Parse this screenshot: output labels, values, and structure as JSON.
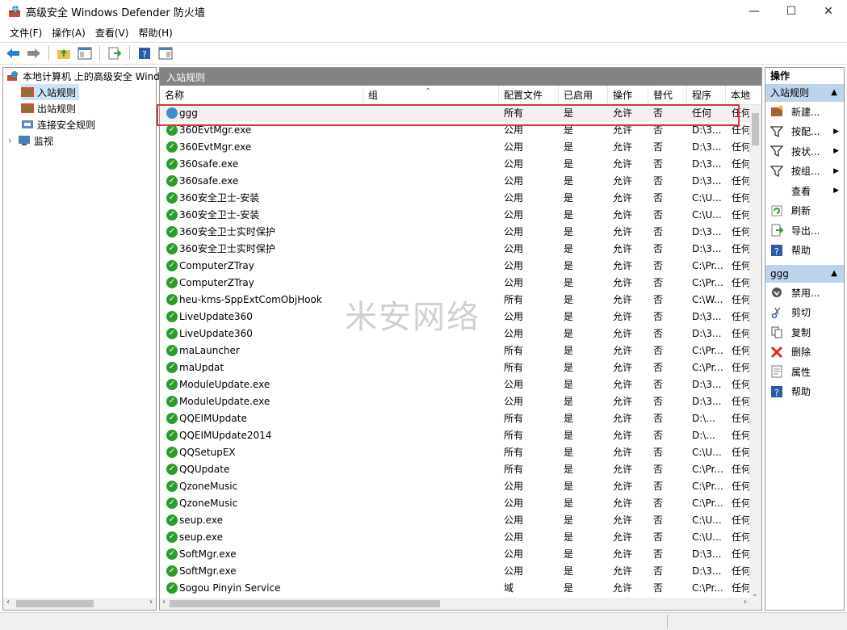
{
  "window": {
    "title": "高级安全 Windows Defender 防火墙",
    "minimize": "—",
    "maximize": "☐",
    "close": "✕"
  },
  "menu": [
    "文件(F)",
    "操作(A)",
    "查看(V)",
    "帮助(H)"
  ],
  "toolbar_icons": [
    "back-arrow-icon",
    "forward-arrow-icon",
    "up-folder-icon",
    "show-hide-tree-icon",
    "export-icon",
    "help-icon",
    "view-pane-icon"
  ],
  "tree": {
    "root": "本地计算机 上的高级安全 Windows Defender",
    "items": [
      "入站规则",
      "出站规则",
      "连接安全规则",
      "监视"
    ],
    "expander": "›"
  },
  "center": {
    "title": "入站规则",
    "columns": [
      "名称",
      "组",
      "配置文件",
      "已启用",
      "操作",
      "替代",
      "程序",
      "本地"
    ],
    "rows": [
      {
        "name": "ggg",
        "group": "",
        "profile": "所有",
        "enabled": "是",
        "action": "允许",
        "override": "否",
        "program": "任何",
        "local": "任何",
        "icon": "globe"
      },
      {
        "name": "360EvtMgr.exe",
        "group": "",
        "profile": "公用",
        "enabled": "是",
        "action": "允许",
        "override": "否",
        "program": "D:\\3...",
        "local": "任何",
        "icon": "check"
      },
      {
        "name": "360EvtMgr.exe",
        "group": "",
        "profile": "公用",
        "enabled": "是",
        "action": "允许",
        "override": "否",
        "program": "D:\\3...",
        "local": "任何",
        "icon": "check"
      },
      {
        "name": "360safe.exe",
        "group": "",
        "profile": "公用",
        "enabled": "是",
        "action": "允许",
        "override": "否",
        "program": "D:\\3...",
        "local": "任何",
        "icon": "check"
      },
      {
        "name": "360safe.exe",
        "group": "",
        "profile": "公用",
        "enabled": "是",
        "action": "允许",
        "override": "否",
        "program": "D:\\3...",
        "local": "任何",
        "icon": "check"
      },
      {
        "name": "360安全卫士-安装",
        "group": "",
        "profile": "公用",
        "enabled": "是",
        "action": "允许",
        "override": "否",
        "program": "C:\\U...",
        "local": "任何",
        "icon": "check"
      },
      {
        "name": "360安全卫士-安装",
        "group": "",
        "profile": "公用",
        "enabled": "是",
        "action": "允许",
        "override": "否",
        "program": "C:\\U...",
        "local": "任何",
        "icon": "check"
      },
      {
        "name": "360安全卫士实时保护",
        "group": "",
        "profile": "公用",
        "enabled": "是",
        "action": "允许",
        "override": "否",
        "program": "D:\\3...",
        "local": "任何",
        "icon": "check"
      },
      {
        "name": "360安全卫士实时保护",
        "group": "",
        "profile": "公用",
        "enabled": "是",
        "action": "允许",
        "override": "否",
        "program": "D:\\3...",
        "local": "任何",
        "icon": "check"
      },
      {
        "name": "ComputerZTray",
        "group": "",
        "profile": "公用",
        "enabled": "是",
        "action": "允许",
        "override": "否",
        "program": "C:\\Pr...",
        "local": "任何",
        "icon": "check"
      },
      {
        "name": "ComputerZTray",
        "group": "",
        "profile": "公用",
        "enabled": "是",
        "action": "允许",
        "override": "否",
        "program": "C:\\Pr...",
        "local": "任何",
        "icon": "check"
      },
      {
        "name": "heu-kms-SppExtComObjHook",
        "group": "",
        "profile": "所有",
        "enabled": "是",
        "action": "允许",
        "override": "否",
        "program": "C:\\W...",
        "local": "任何",
        "icon": "check"
      },
      {
        "name": "LiveUpdate360",
        "group": "",
        "profile": "公用",
        "enabled": "是",
        "action": "允许",
        "override": "否",
        "program": "D:\\3...",
        "local": "任何",
        "icon": "check"
      },
      {
        "name": "LiveUpdate360",
        "group": "",
        "profile": "公用",
        "enabled": "是",
        "action": "允许",
        "override": "否",
        "program": "D:\\3...",
        "local": "任何",
        "icon": "check"
      },
      {
        "name": "maLauncher",
        "group": "",
        "profile": "所有",
        "enabled": "是",
        "action": "允许",
        "override": "否",
        "program": "C:\\Pr...",
        "local": "任何",
        "icon": "check"
      },
      {
        "name": "maUpdat",
        "group": "",
        "profile": "所有",
        "enabled": "是",
        "action": "允许",
        "override": "否",
        "program": "C:\\Pr...",
        "local": "任何",
        "icon": "check"
      },
      {
        "name": "ModuleUpdate.exe",
        "group": "",
        "profile": "公用",
        "enabled": "是",
        "action": "允许",
        "override": "否",
        "program": "D:\\3...",
        "local": "任何",
        "icon": "check"
      },
      {
        "name": "ModuleUpdate.exe",
        "group": "",
        "profile": "公用",
        "enabled": "是",
        "action": "允许",
        "override": "否",
        "program": "D:\\3...",
        "local": "任何",
        "icon": "check"
      },
      {
        "name": "QQEIMUpdate",
        "group": "",
        "profile": "所有",
        "enabled": "是",
        "action": "允许",
        "override": "否",
        "program": "D:\\...",
        "local": "任何",
        "icon": "check"
      },
      {
        "name": "QQEIMUpdate2014",
        "group": "",
        "profile": "所有",
        "enabled": "是",
        "action": "允许",
        "override": "否",
        "program": "D:\\...",
        "local": "任何",
        "icon": "check"
      },
      {
        "name": "QQSetupEX",
        "group": "",
        "profile": "所有",
        "enabled": "是",
        "action": "允许",
        "override": "否",
        "program": "C:\\U...",
        "local": "任何",
        "icon": "check"
      },
      {
        "name": "QQUpdate",
        "group": "",
        "profile": "所有",
        "enabled": "是",
        "action": "允许",
        "override": "否",
        "program": "C:\\Pr...",
        "local": "任何",
        "icon": "check"
      },
      {
        "name": "QzoneMusic",
        "group": "",
        "profile": "公用",
        "enabled": "是",
        "action": "允许",
        "override": "否",
        "program": "C:\\Pr...",
        "local": "任何",
        "icon": "check"
      },
      {
        "name": "QzoneMusic",
        "group": "",
        "profile": "公用",
        "enabled": "是",
        "action": "允许",
        "override": "否",
        "program": "C:\\Pr...",
        "local": "任何",
        "icon": "check"
      },
      {
        "name": "seup.exe",
        "group": "",
        "profile": "公用",
        "enabled": "是",
        "action": "允许",
        "override": "否",
        "program": "C:\\U...",
        "local": "任何",
        "icon": "check"
      },
      {
        "name": "seup.exe",
        "group": "",
        "profile": "公用",
        "enabled": "是",
        "action": "允许",
        "override": "否",
        "program": "C:\\U...",
        "local": "任何",
        "icon": "check"
      },
      {
        "name": "SoftMgr.exe",
        "group": "",
        "profile": "公用",
        "enabled": "是",
        "action": "允许",
        "override": "否",
        "program": "D:\\3...",
        "local": "任何",
        "icon": "check"
      },
      {
        "name": "SoftMgr.exe",
        "group": "",
        "profile": "公用",
        "enabled": "是",
        "action": "允许",
        "override": "否",
        "program": "D:\\3...",
        "local": "任何",
        "icon": "check"
      },
      {
        "name": "Sogou Pinyin Service",
        "group": "",
        "profile": "域",
        "enabled": "是",
        "action": "允许",
        "override": "否",
        "program": "C:\\Pr...",
        "local": "任何",
        "icon": "check"
      }
    ]
  },
  "actions": {
    "header": "操作",
    "section1": {
      "title": "入站规则",
      "items": [
        {
          "label": "新建...",
          "icon": "new-rule-icon",
          "arrow": false
        },
        {
          "label": "按配...",
          "icon": "filter-icon",
          "arrow": true
        },
        {
          "label": "按状...",
          "icon": "filter-icon",
          "arrow": true
        },
        {
          "label": "按组...",
          "icon": "filter-icon",
          "arrow": true
        },
        {
          "label": "查看",
          "icon": "",
          "arrow": true
        },
        {
          "label": "刷新",
          "icon": "refresh-icon",
          "arrow": false
        },
        {
          "label": "导出...",
          "icon": "export-icon",
          "arrow": false
        },
        {
          "label": "帮助",
          "icon": "help-icon",
          "arrow": false
        }
      ]
    },
    "section2": {
      "title": "ggg",
      "items": [
        {
          "label": "禁用...",
          "icon": "disable-icon",
          "arrow": false
        },
        {
          "label": "剪切",
          "icon": "cut-icon",
          "arrow": false
        },
        {
          "label": "复制",
          "icon": "copy-icon",
          "arrow": false
        },
        {
          "label": "删除",
          "icon": "delete-icon",
          "arrow": false
        },
        {
          "label": "属性",
          "icon": "properties-icon",
          "arrow": false
        },
        {
          "label": "帮助",
          "icon": "help-icon",
          "arrow": false
        }
      ]
    }
  },
  "watermark": "米安网络",
  "colors": {
    "pane_title_bg": "#838383",
    "action_section_bg": "#bcd3ec",
    "highlight_border": "#d9363e",
    "check_green": "#2e9b2e"
  }
}
